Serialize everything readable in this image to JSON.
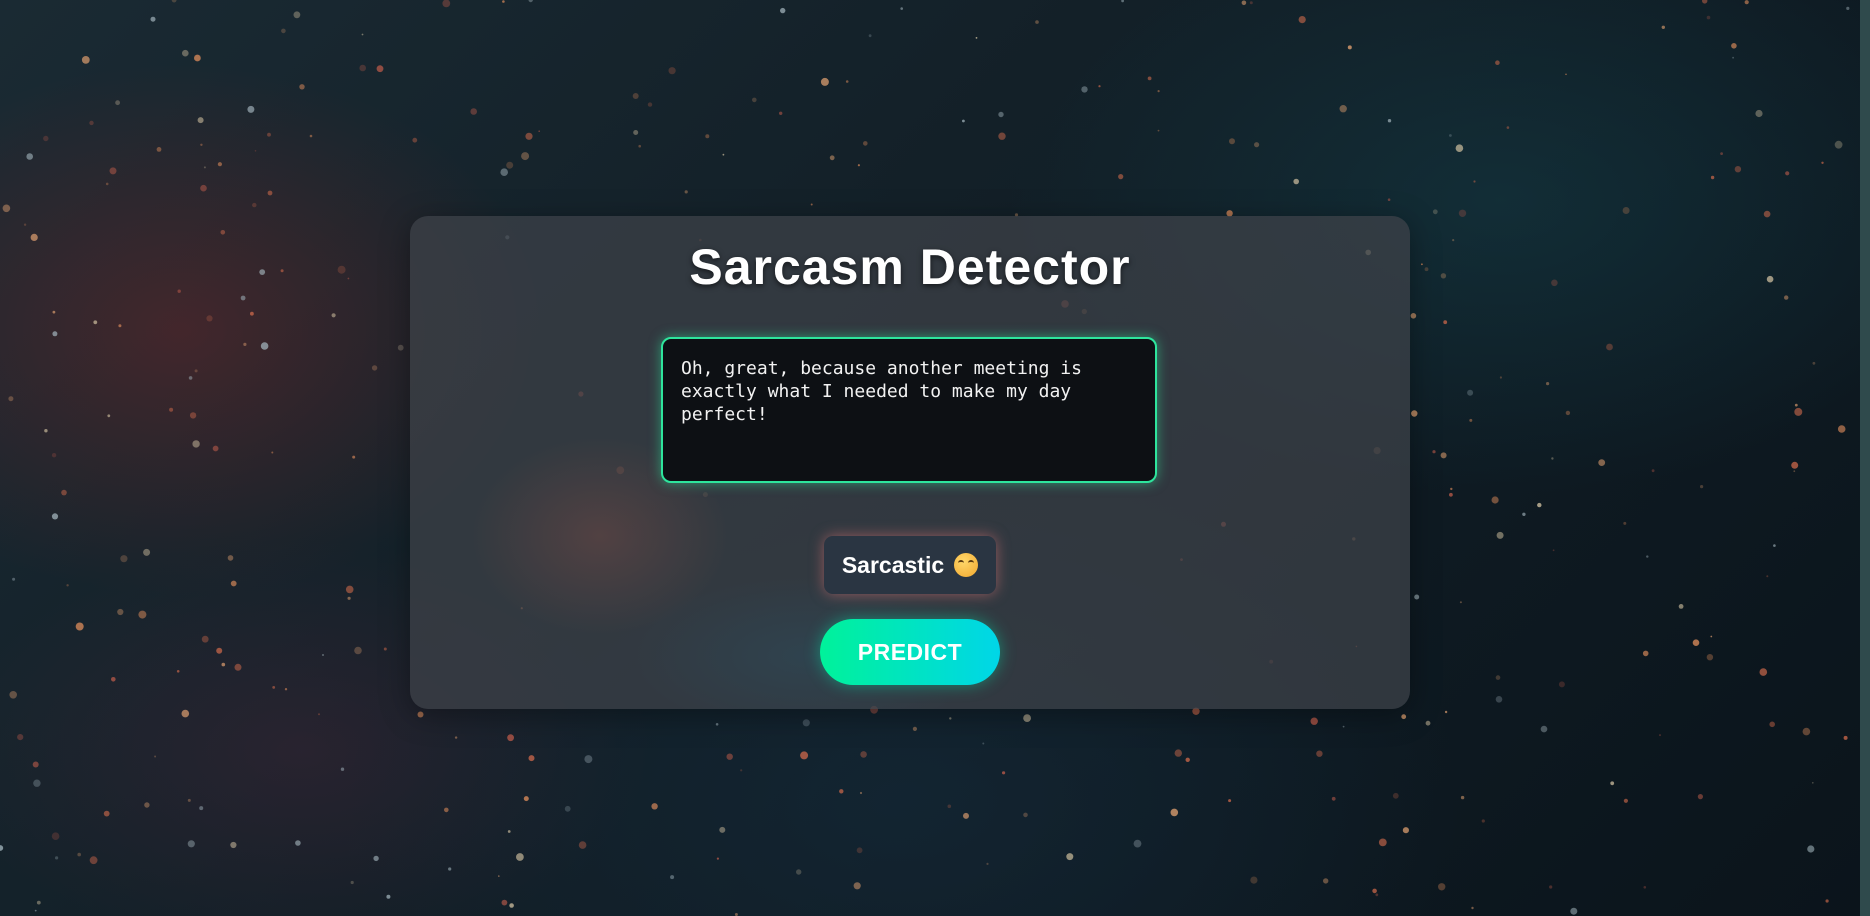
{
  "app": {
    "title": "Sarcasm Detector"
  },
  "input": {
    "value": "Oh, great, because another meeting is exactly what I needed to make my day perfect!"
  },
  "result": {
    "label": "Sarcastic",
    "icon": "rolling-eyes-face-emoji"
  },
  "actions": {
    "predict_label": "PREDICT"
  },
  "colors": {
    "input_border": "#2ee59d",
    "button_gradient_start": "#00f29a",
    "button_gradient_end": "#00d6e8",
    "result_background": "#2a3542",
    "result_glow": "#e67878"
  }
}
